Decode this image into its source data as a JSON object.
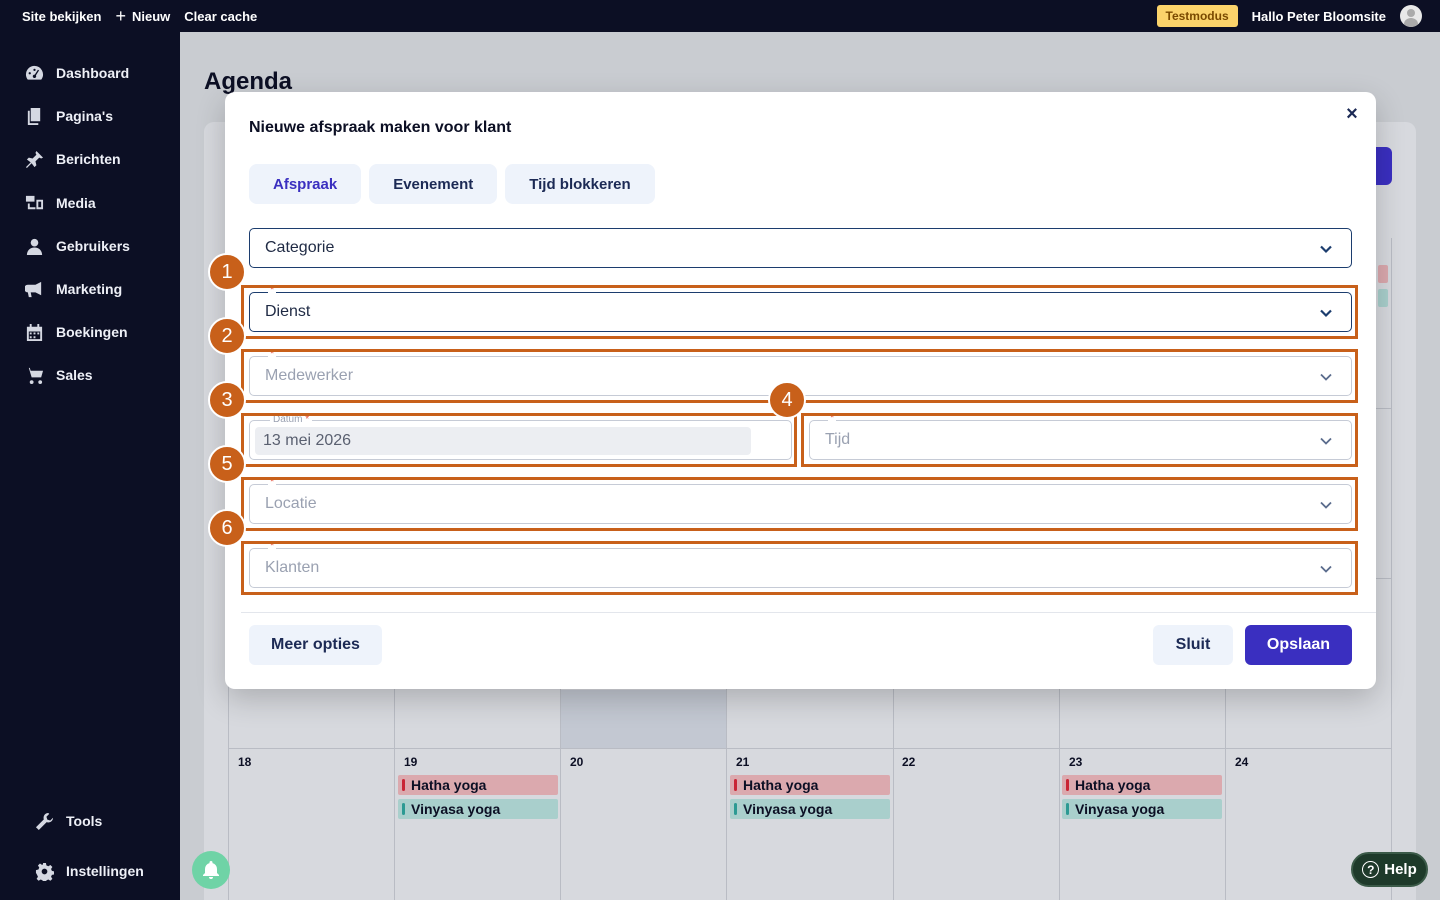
{
  "topbar": {
    "view_site": "Site bekijken",
    "new_label": "Nieuw",
    "clear_cache": "Clear cache",
    "test_mode": "Testmodus",
    "greeting": "Hallo Peter Bloomsite"
  },
  "sidebar": {
    "items": [
      {
        "label": "Dashboard",
        "icon": "dashboard-icon"
      },
      {
        "label": "Pagina's",
        "icon": "pages-icon"
      },
      {
        "label": "Berichten",
        "icon": "pin-icon"
      },
      {
        "label": "Media",
        "icon": "media-icon"
      },
      {
        "label": "Gebruikers",
        "icon": "user-icon"
      },
      {
        "label": "Marketing",
        "icon": "megaphone-icon"
      },
      {
        "label": "Boekingen",
        "icon": "calendar-icon"
      },
      {
        "label": "Sales",
        "icon": "cart-icon"
      }
    ],
    "tools": "Tools",
    "settings": "Instellingen"
  },
  "page": {
    "title": "Agenda"
  },
  "calendar": {
    "days": [
      "18",
      "19",
      "20",
      "21",
      "22",
      "23",
      "24"
    ],
    "events": {
      "hatha": "Hatha yoga",
      "vinyasa": "Vinyasa yoga"
    }
  },
  "modal": {
    "title": "Nieuwe afspraak maken voor klant",
    "close": "×",
    "tabs": [
      "Afspraak",
      "Evenement",
      "Tijd blokkeren"
    ],
    "active_tab": "Afspraak",
    "fields": {
      "category": "Categorie",
      "service": "Dienst",
      "employee": "Medewerker",
      "date_label": "Datum",
      "date_value": "13 mei 2026",
      "time": "Tijd",
      "location": "Locatie",
      "clients": "Klanten",
      "required_mark": "*"
    },
    "buttons": {
      "more_options": "Meer opties",
      "close": "Sluit",
      "save": "Opslaan"
    }
  },
  "annotations": [
    "1",
    "2",
    "3",
    "4",
    "5",
    "6"
  ],
  "help": "Help",
  "colors": {
    "accent": "#3a2fc0",
    "annotation": "#c8601a",
    "admin_bar": "#0c0f24"
  }
}
